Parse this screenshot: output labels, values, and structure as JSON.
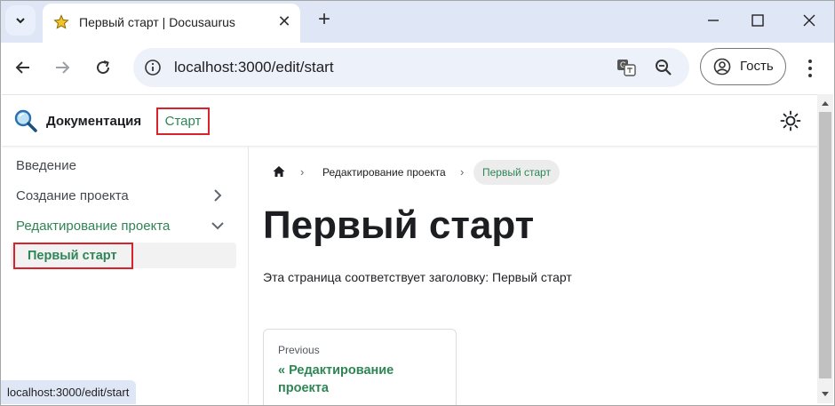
{
  "browser": {
    "tab_title": "Первый старт | Docusaurus",
    "url": "localhost:3000/edit/start",
    "guest_label": "Гость",
    "status_url": "localhost:3000/edit/start"
  },
  "navbar": {
    "brand_title": "Документация",
    "start_link": "Старт"
  },
  "sidebar": {
    "items": [
      {
        "label": "Введение"
      },
      {
        "label": "Создание проекта"
      },
      {
        "label": "Редактирование проекта"
      },
      {
        "label": "Первый старт"
      }
    ]
  },
  "breadcrumbs": {
    "items": [
      "Редактирование проекта",
      "Первый старт"
    ]
  },
  "content": {
    "title": "Первый старт",
    "text": "Эта страница соответствует заголовку: Первый старт",
    "pager_sub": "Previous",
    "pager_label": "« Редактирование проекта"
  },
  "colors": {
    "accent": "#2e8555",
    "highlight_box": "#d9222a",
    "tabbar": "#dfe6f5"
  }
}
